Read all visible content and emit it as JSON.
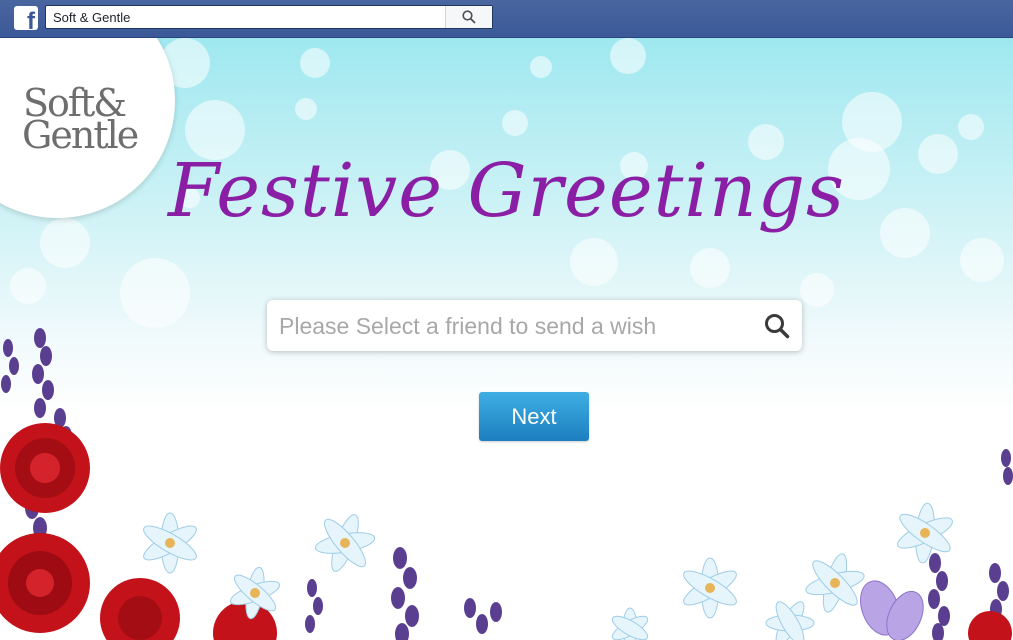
{
  "fb_bar": {
    "logo_glyph": "f",
    "search_value": "Soft & Gentle",
    "search_icon": "search-icon"
  },
  "brand": {
    "logo_line1": "Soft&",
    "logo_line2": "Gentle"
  },
  "main": {
    "title": "Festive Greetings",
    "friend_search_placeholder": "Please Select a friend to send a wish",
    "next_label": "Next"
  },
  "colors": {
    "fb_blue": "#3b5998",
    "title_purple": "#8a1fa6",
    "button_blue": "#2a93d0",
    "sky": "#9fe8f0"
  }
}
